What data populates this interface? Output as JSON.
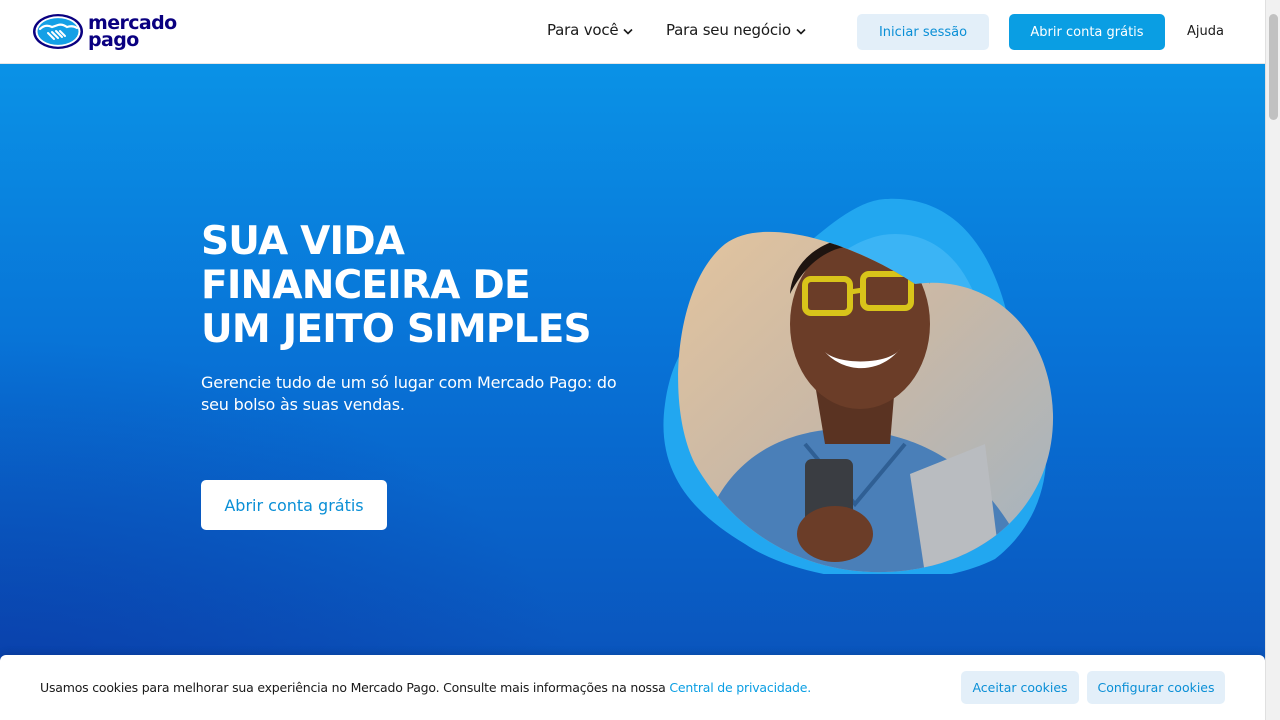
{
  "brand": {
    "name_line1": "mercado",
    "name_line2": "pago",
    "logo_icon": "handshake-icon",
    "color_primary": "#0a0080",
    "color_accent": "#0a9ee3"
  },
  "header": {
    "nav": [
      {
        "label": "Para você",
        "icon": "chevron-down-icon"
      },
      {
        "label": "Para seu negócio",
        "icon": "chevron-down-icon"
      }
    ],
    "login_label": "Iniciar sessão",
    "open_account_label": "Abrir conta grátis",
    "help_label": "Ajuda"
  },
  "hero": {
    "title_line1": "SUA VIDA",
    "title_line2": "FINANCEIRA DE",
    "title_line3": "UM JEITO SIMPLES",
    "subtitle": "Gerencie tudo de um só lugar com Mercado Pago: do seu bolso às suas vendas.",
    "cta_label": "Abrir conta grátis",
    "background_gradient": [
      "#0a92e6",
      "#0872d6",
      "#0a4fb8"
    ]
  },
  "cookie_banner": {
    "text": "Usamos cookies para melhorar sua experiência no Mercado Pago. Consulte mais informações na nossa ",
    "link_label": "Central de privacidade.",
    "accept_label": "Aceitar cookies",
    "configure_label": "Configurar cookies"
  }
}
